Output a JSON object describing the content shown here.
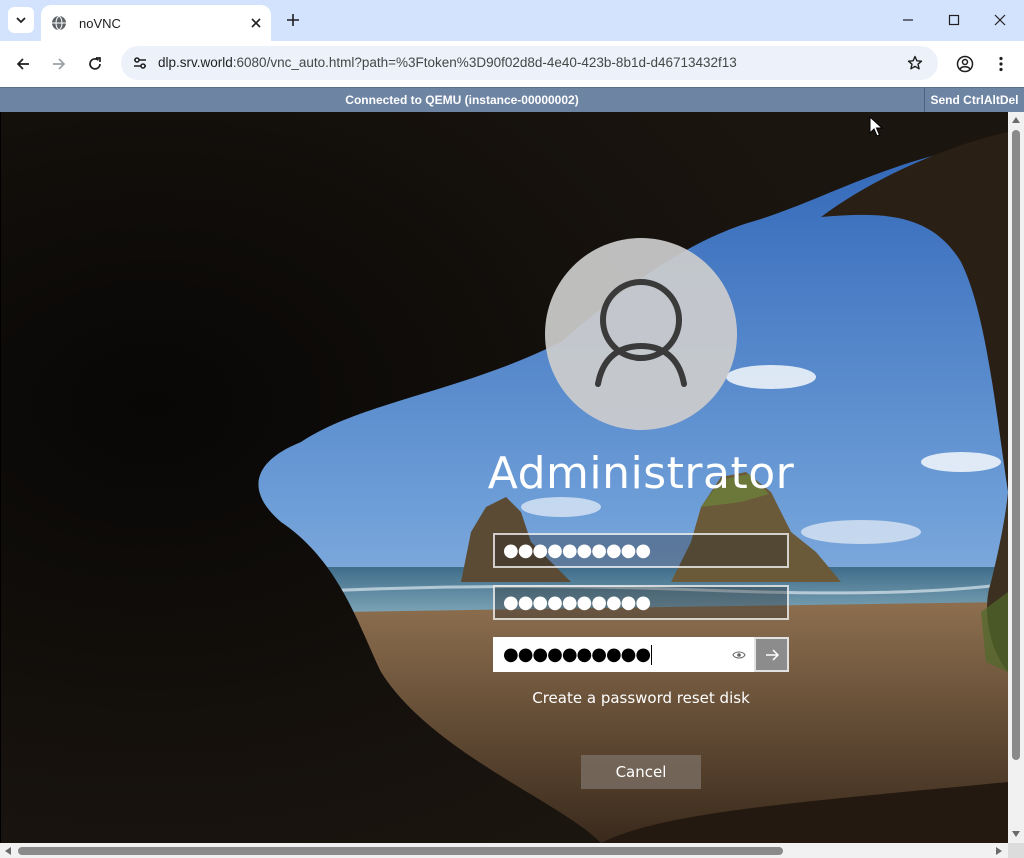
{
  "browser": {
    "tab_title": "noVNC",
    "url_host": "dlp.srv.world",
    "url_rest": ":6080/vnc_auto.html?path=%3Ftoken%3D90f02d8d-4e40-423b-8b1d-d46713432f13"
  },
  "vnc": {
    "status": "Connected to QEMU (instance-00000002)",
    "send_cad_label": "Send CtrlAltDel"
  },
  "login": {
    "username": "Administrator",
    "old_password_mask": "●●●●●●●●●●",
    "new_password_mask": "●●●●●●●●●●",
    "confirm_password_mask": "●●●●●●●●●●",
    "reset_disk_link": "Create a password reset disk",
    "cancel_label": "Cancel"
  },
  "colors": {
    "tabstrip": "#d3e3fd",
    "vnc_bar": "#6e84a3"
  },
  "icons": {
    "tab_search": "chevron-down-icon",
    "favicon": "globe-icon",
    "tab_close": "close-icon",
    "new_tab": "plus-icon",
    "back": "arrow-left-icon",
    "forward": "arrow-right-icon",
    "reload": "reload-icon",
    "site_info": "tune-icon",
    "bookmark": "star-icon",
    "profile": "person-circle-icon",
    "menu": "kebab-menu-icon",
    "reveal": "eye-icon",
    "submit": "arrow-right-icon"
  }
}
